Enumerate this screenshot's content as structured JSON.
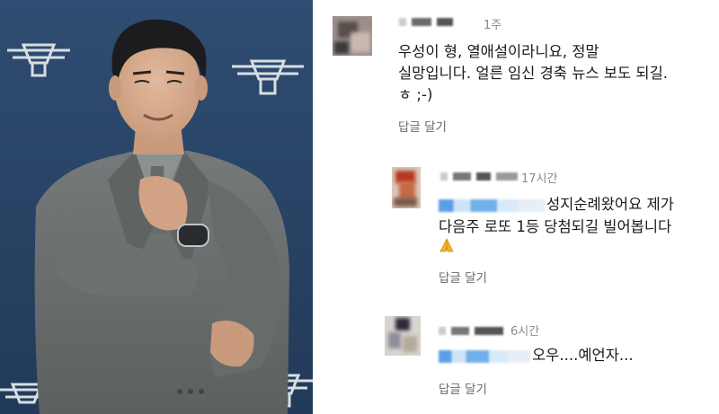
{
  "comments": [
    {
      "time": "1주",
      "lines": [
        "우성이 형, 열애설이라니요, 정말",
        "실망입니다. 얼른 임신 경축 뉴스 보도 되길.",
        "ㅎ ;-)"
      ],
      "reply_label": "답글 달기"
    },
    {
      "time": "17시간",
      "lines": [
        "성지순례왔어요 제가",
        "다음주 로또 1등 당첨되길 빌어봅니다"
      ],
      "emoji": "pray-hands-icon",
      "reply_label": "답글 달기"
    },
    {
      "time": "6시간",
      "lines": [
        "오우....예언자..."
      ],
      "reply_label": "답글 달기"
    }
  ],
  "colors": {
    "backdrop": "#294466",
    "suit": "#6b6f6d",
    "text": "#1a1a1a",
    "meta": "#8a8a8a",
    "mention_blur": "#5aa0e6"
  }
}
